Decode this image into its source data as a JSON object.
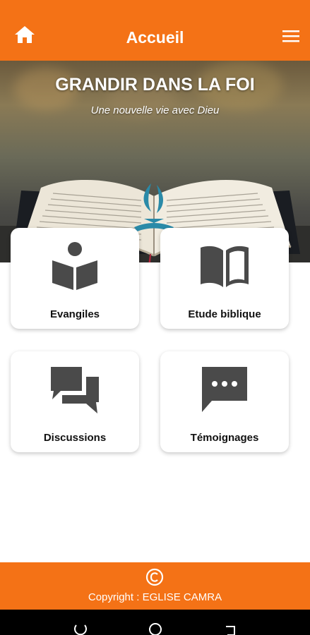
{
  "app_bar": {
    "title": "Accueil",
    "home_icon": "home-icon",
    "menu_icon": "hamburger-menu-icon"
  },
  "hero": {
    "title": "GRANDIR DANS LA FOI",
    "subtitle": "Une nouvelle vie avec Dieu"
  },
  "cards": [
    {
      "label": "Evangiles",
      "icon": "reader-book-icon"
    },
    {
      "label": "Etude biblique",
      "icon": "open-book-icon"
    },
    {
      "label": "Discussions",
      "icon": "chat-bubbles-icon"
    },
    {
      "label": "Témoignages",
      "icon": "comment-dots-icon"
    }
  ],
  "footer": {
    "copyright_icon": "copyright-icon",
    "text": "Copyright : EGLISE CAMRA"
  },
  "colors": {
    "primary": "#f47216",
    "icon": "#4a4a4a",
    "nav_bar": "#000000"
  }
}
